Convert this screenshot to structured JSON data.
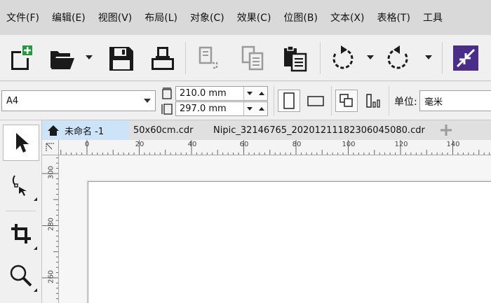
{
  "menu": [
    "文件(F)",
    "编辑(E)",
    "视图(V)",
    "布局(L)",
    "对象(C)",
    "效果(C)",
    "位图(B)",
    "文本(X)",
    "表格(T)",
    "工具"
  ],
  "toolbar": {
    "icons": [
      "new-document-icon",
      "open-folder-icon",
      "save-icon",
      "print-icon",
      "cut-icon",
      "copy-icon",
      "paste-icon",
      "undo-icon",
      "redo-icon",
      "import-export-icon"
    ]
  },
  "propbar": {
    "page_size": "A4",
    "width": "210.0 mm",
    "height": "297.0 mm",
    "unit_label": "单位:",
    "unit_value": "毫米"
  },
  "tabs": [
    {
      "label": "未命名 -1",
      "active": true
    },
    {
      "label": "50x60cm.cdr",
      "active": false
    },
    {
      "label": "Nipic_32146765_20201211182306045080.cdr",
      "active": false
    }
  ],
  "hruler": [
    "0",
    "20",
    "40",
    "60",
    "80",
    "100",
    "120",
    "140"
  ],
  "vruler": [
    "300",
    "280",
    "260"
  ],
  "colors": {
    "active_tab": "#cde3f7",
    "menubar": "#d9d9d9",
    "accent_button": "#4a2d8a",
    "new_plus": "#1f9d3a"
  }
}
